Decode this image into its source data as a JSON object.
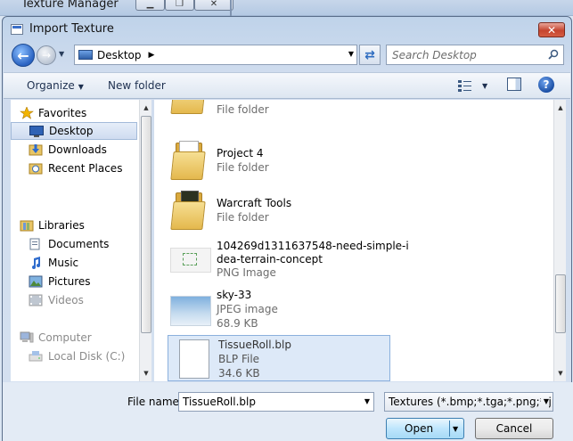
{
  "background_window": {
    "title": "Texture Manager"
  },
  "dialog": {
    "title": "Import Texture",
    "close_glyph": "✕"
  },
  "nav": {
    "address": "Desktop",
    "search_placeholder": "Search Desktop"
  },
  "toolbar": {
    "organize": "Organize",
    "new_folder": "New folder",
    "help": "?"
  },
  "sidebar": {
    "groups": [
      {
        "label": "Favorites",
        "icon": "star-icon"
      },
      {
        "label": "Libraries",
        "icon": "libraries-icon"
      },
      {
        "label": "Computer",
        "icon": "computer-icon"
      }
    ],
    "items": [
      {
        "label": "Desktop",
        "icon": "desktop-icon",
        "selected": true
      },
      {
        "label": "Downloads",
        "icon": "downloads-icon"
      },
      {
        "label": "Recent Places",
        "icon": "recent-places-icon"
      },
      {
        "label": "Documents",
        "icon": "documents-icon"
      },
      {
        "label": "Music",
        "icon": "music-icon"
      },
      {
        "label": "Pictures",
        "icon": "pictures-icon"
      },
      {
        "label": "Videos",
        "icon": "videos-icon"
      },
      {
        "label": "Local Disk (C:)",
        "icon": "disk-icon"
      }
    ]
  },
  "files": [
    {
      "name": "",
      "type": "File folder",
      "size": ""
    },
    {
      "name": "Project 4",
      "type": "File folder",
      "size": ""
    },
    {
      "name": "Warcraft Tools",
      "type": "File folder",
      "size": ""
    },
    {
      "name": "104269d1311637548-need-simple-i",
      "name2": "dea-terrain-concept",
      "type": "PNG Image",
      "size": ""
    },
    {
      "name": "sky-33",
      "type": "JPEG image",
      "size": "68.9 KB"
    },
    {
      "name": "TissueRoll.blp",
      "type": "BLP File",
      "size": "34.6 KB",
      "selected": true
    }
  ],
  "footer": {
    "file_name_label": "File name:",
    "file_name_value": "TissueRoll.blp",
    "file_type": "Textures (*.bmp;*.tga;*.png;*.jp",
    "open": "Open",
    "cancel": "Cancel"
  },
  "colors": {
    "accent": "#2a63c2",
    "selection": "#dde9f8",
    "close": "#c6452f"
  }
}
